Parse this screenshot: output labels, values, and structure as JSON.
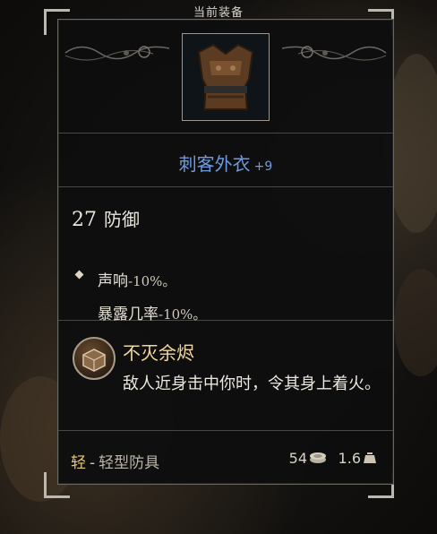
{
  "header": {
    "title": "当前装备"
  },
  "item": {
    "image_icon": "leather-armor-icon",
    "name": "刺客外衣",
    "upgrade": "+9",
    "armor_value": "27",
    "armor_label": "防御",
    "modifiers": [
      {
        "label": "声响",
        "value": "-10%。"
      },
      {
        "label": "暴露几率",
        "value": "-10%。"
      }
    ],
    "passive": {
      "icon": "burning-box-icon",
      "title": "不灭余烬",
      "description": "敌人近身击中你时，令其身上着火。"
    },
    "footer": {
      "weight_class": "轻",
      "separator": "-",
      "armor_type": "轻型防具",
      "price": "54",
      "price_icon": "coin-stack-icon",
      "weight": "1.6",
      "weight_icon": "weight-icon"
    }
  },
  "colors": {
    "name_blue": "#6d9be0",
    "passive_gold": "#f0d79b",
    "weight_class_gold": "#e3c776"
  }
}
